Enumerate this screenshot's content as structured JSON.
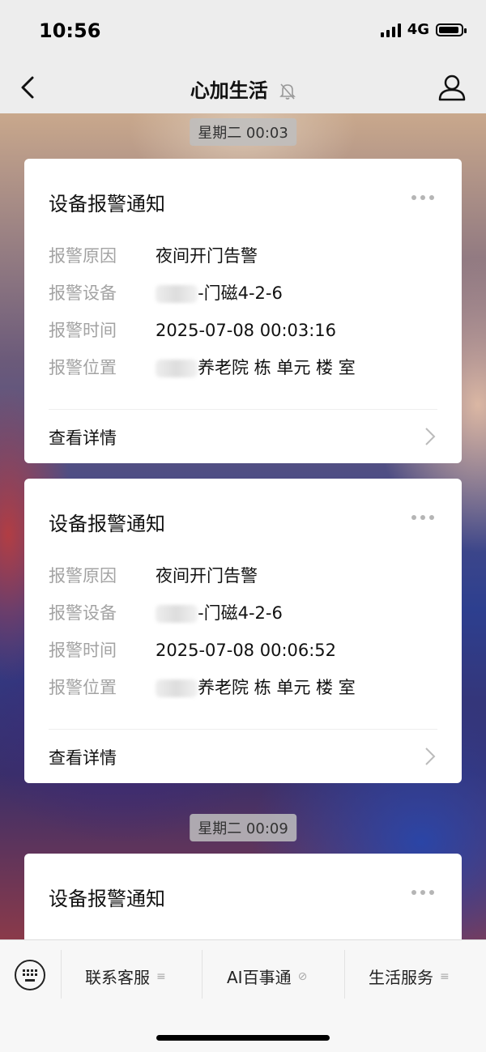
{
  "status_bar": {
    "time": "10:56",
    "network": "4G"
  },
  "nav": {
    "title": "心加生活"
  },
  "timestamps": [
    "星期二 00:03",
    "星期二 00:09"
  ],
  "cards": [
    {
      "title": "设备报警通知",
      "rows": [
        {
          "label": "报警原因",
          "value": "夜间开门告警"
        },
        {
          "label": "报警设备",
          "value": "-门磁4-2-6"
        },
        {
          "label": "报警时间",
          "value": "2025-07-08 00:03:16"
        },
        {
          "label": "报警位置",
          "value": "养老院 栋 单元 楼 室"
        }
      ],
      "detail": "查看详情"
    },
    {
      "title": "设备报警通知",
      "rows": [
        {
          "label": "报警原因",
          "value": "夜间开门告警"
        },
        {
          "label": "报警设备",
          "value": "-门磁4-2-6"
        },
        {
          "label": "报警时间",
          "value": "2025-07-08 00:06:52"
        },
        {
          "label": "报警位置",
          "value": "养老院 栋 单元 楼 室"
        }
      ],
      "detail": "查看详情"
    },
    {
      "title": "设备报警通知"
    }
  ],
  "menu": [
    "联系客服",
    "AI百事通",
    "生活服务"
  ]
}
